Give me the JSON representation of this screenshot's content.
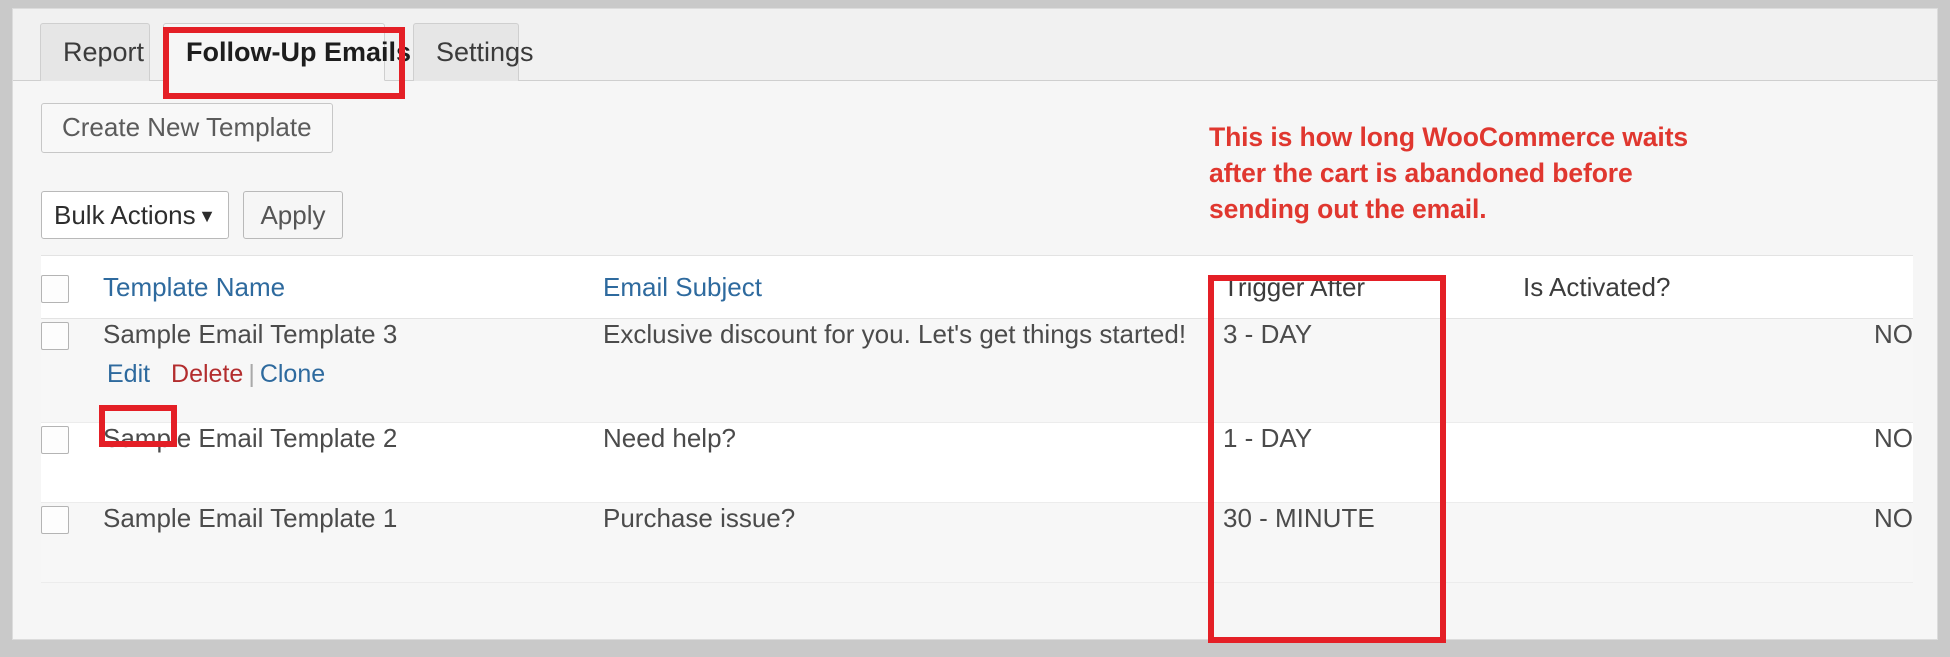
{
  "tabs": [
    {
      "label": "Report",
      "active": false
    },
    {
      "label": "Follow-Up Emails",
      "active": true
    },
    {
      "label": "Settings",
      "active": false
    }
  ],
  "toolbar": {
    "create_new_template": "Create New Template",
    "bulk_actions_value": "Bulk Actions",
    "bulk_actions_caret": "▼",
    "apply_label": "Apply"
  },
  "annotation": {
    "note": "This is how long WooCommerce waits after the cart is abandoned before sending out the email.",
    "color": "#e0372f"
  },
  "table": {
    "headers": {
      "template_name": "Template Name",
      "email_subject": "Email Subject",
      "trigger_after": "Trigger After",
      "is_activated": "Is Activated?"
    },
    "rows": [
      {
        "name": "Sample Email Template 3",
        "subject": "Exclusive discount for you. Let's get things started!",
        "trigger": "3 - DAY",
        "activated": "NO",
        "actions": {
          "edit": "Edit",
          "delete": "Delete",
          "clone": "Clone",
          "separator": "|"
        }
      },
      {
        "name": "Sample Email Template 2",
        "subject": "Need help?",
        "trigger": "1 - DAY",
        "activated": "NO"
      },
      {
        "name": "Sample Email Template 1",
        "subject": "Purchase issue?",
        "trigger": "30 - MINUTE",
        "activated": "NO"
      }
    ]
  },
  "colors": {
    "link": "#2e6a9e",
    "delete": "#b32d2e",
    "highlight": "#e41f26"
  }
}
